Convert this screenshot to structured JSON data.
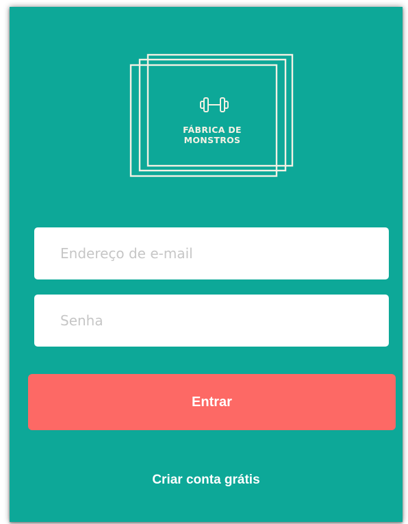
{
  "brand": {
    "name_line1": "FÁBRICA DE",
    "name_line2": "MONSTROS",
    "icon": "dumbbell-icon"
  },
  "form": {
    "email_placeholder": "Endereço de e-mail",
    "password_placeholder": "Senha",
    "submit_label": "Entrar",
    "signup_label": "Criar conta grátis"
  },
  "colors": {
    "background": "#0da898",
    "primary_button": "#fd6965",
    "logo_stroke": "#f4f1e4",
    "field_background": "#ffffff",
    "placeholder": "#c6c6c6"
  }
}
